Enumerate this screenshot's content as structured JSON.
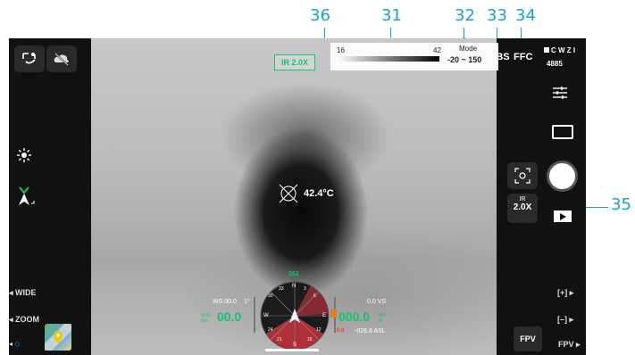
{
  "callouts": {
    "c36": "36",
    "c31": "31",
    "c32": "32",
    "c33": "33",
    "c34": "34",
    "c35": "35"
  },
  "top_bar": {
    "palette_min": "16",
    "palette_max": "42",
    "mode_label": "Mode",
    "range": "-20 ~ 150",
    "sbs_label": "SBS",
    "ffc_label": "FFC",
    "cwzi_label": "C W Z I",
    "cwzi_value": "4885"
  },
  "view": {
    "ir_badge": "IR 2.0X",
    "spot_temperature": "42.4°C"
  },
  "left_panel": {
    "wide_label": "WIDE",
    "zoom_label": "ZOOM"
  },
  "right_panel": {
    "ir_label": "IR",
    "ir_zoom": "2.0X",
    "plus_label": "[+]",
    "minus_label": "[–]",
    "fpv_button": "FPV",
    "fpv_label": "FPV"
  },
  "telemetry": {
    "heading": "262",
    "ws": "WS 00.0",
    "ws_unit": "1°",
    "h_speed": "00.0",
    "h_speed_unit_top": "SPD",
    "h_speed_unit_bottom": "m/s",
    "vs": "0.0 VS",
    "altitude": "000.0",
    "alt_unit_top": "ALT",
    "alt_unit_bottom": "m",
    "asl": "-026.8 ASL",
    "alt_marker_top": "1.0",
    "alt_marker_bottom": "0.0"
  },
  "compass_labels": [
    "N",
    "E",
    "S",
    "W",
    "3",
    "6",
    "12",
    "15",
    "21",
    "24",
    "30",
    "33"
  ],
  "colors": {
    "accent": "#1aa0d8",
    "green": "#14c46a",
    "red_zone": "#b0303a"
  }
}
